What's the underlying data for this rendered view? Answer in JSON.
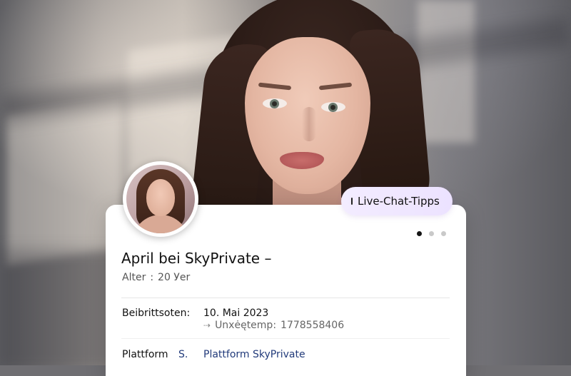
{
  "hero": {
    "image_alt": "photo-of-young-woman"
  },
  "profile": {
    "badge_label": "Live-Chat-Tipps",
    "title": "April bei SkyPrivate –",
    "age_label": "Alter",
    "age_separator": ":",
    "age_value": "20 Уer",
    "carousel": {
      "count": 3,
      "active_index": 0
    }
  },
  "details": {
    "joined_label": "Beibrittsoten:",
    "joined_date": "10. Mai 2023",
    "unix_label": "Unxėętemp:",
    "unix_value": "1778558406",
    "platform_label": "Plattform",
    "platform_short": "S.",
    "platform_value": "Plattform SkyPrivate"
  },
  "colors": {
    "card_bg": "#ffffff",
    "pill_bg": "#ece2ff",
    "link_blue": "#213a7a",
    "active_dot": "#151515",
    "inactive_dot": "#c9c9c9"
  }
}
